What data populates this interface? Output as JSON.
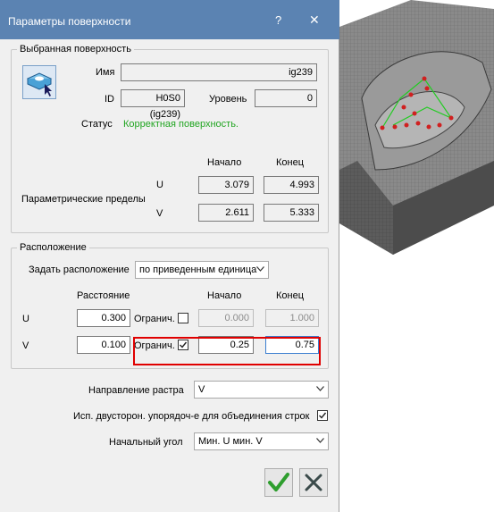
{
  "dialog": {
    "title": "Параметры поверхности",
    "help_glyph": "?",
    "close_glyph": "✕"
  },
  "selected_surface": {
    "legend": "Выбранная поверхность",
    "name_label": "Имя",
    "name_value": "ig239",
    "id_label": "ID",
    "id_value": "H0S0 (ig239)",
    "level_label": "Уровень",
    "level_value": "0",
    "status_label": "Статус",
    "status_value": "Корректная поверхность.",
    "status_color": "#21a521",
    "start_header": "Начало",
    "end_header": "Конец",
    "limits_label": "Параметрические пределы",
    "u_label": "U",
    "v_label": "V",
    "u_start": "3.079",
    "u_end": "4.993",
    "v_start": "2.611",
    "v_end": "5.333"
  },
  "placement": {
    "legend": "Расположение",
    "set_label": "Задать расположение",
    "set_value": "по приведенным единица",
    "distance_header": "Расстояние",
    "start_header": "Начало",
    "end_header": "Конец",
    "u_label": "U",
    "v_label": "V",
    "limit_label": "Огранич.",
    "u_distance": "0.300",
    "u_limit_checked": false,
    "u_start": "0.000",
    "u_end": "1.000",
    "v_distance": "0.100",
    "v_limit_checked": true,
    "v_start": "0.25",
    "v_end": "0.75"
  },
  "raster": {
    "direction_label": "Направление растра",
    "direction_value": "V",
    "two_sided_label": "Исп. двусторон. упорядоч-е для объединения строк",
    "two_sided_checked": true,
    "start_angle_label": "Начальный угол",
    "start_angle_value": "Мин. U мин. V"
  },
  "buttons": {
    "ok_icon": "checkmark-icon",
    "cancel_icon": "cross-icon"
  },
  "colors": {
    "titlebar": "#5b83b2",
    "highlight": "#e00000",
    "ok_green": "#2e9e2e",
    "cancel_dark": "#3a4a4a"
  }
}
